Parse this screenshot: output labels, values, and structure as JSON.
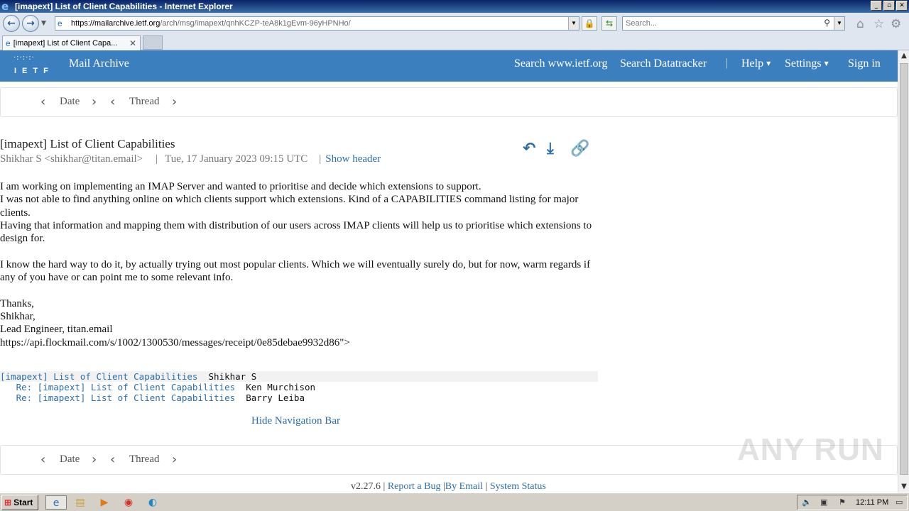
{
  "window": {
    "title": "[imapext] List of Client Capabilities - Internet Explorer",
    "controls": {
      "minimize": "_",
      "maximize": "▫",
      "close": "✕"
    }
  },
  "browser": {
    "url_host": "https://mailarchive.ietf.org",
    "url_path": "/arch/msg/imapext/qnhKCZP-teA8k1gEvm-96yHPNHo/",
    "search_placeholder": "Search...",
    "tab_title": "[imapext] List of Client Capa..."
  },
  "site": {
    "logo_text": "IETF",
    "brand": "Mail Archive",
    "nav": {
      "search_ietf": "Search www.ietf.org",
      "search_datatracker": "Search Datatracker",
      "separator": "|",
      "help": "Help",
      "settings": "Settings",
      "sign_in": "Sign in"
    }
  },
  "msgnav": {
    "date": "Date",
    "thread": "Thread"
  },
  "message": {
    "subject": "[imapext] List of Client Capabilities",
    "from": "Shikhar S <shikhar@titan.email>",
    "date": "Tue, 17 January 2023 09:15 UTC",
    "show_header": "Show header",
    "separator": "|",
    "body": {
      "line1": "I am working on implementing an IMAP Server and wanted to prioritise and decide which extensions to support.",
      "line2": "I was not able to find anything online on which clients support which extensions. Kind of a CAPABILITIES command listing for major clients.",
      "line3": "Having that information and mapping them with distribution of our users across IMAP clients will help us to prioritise which extensions to design for.",
      "line4": "I know the hard way to do it, by actually trying out most popular clients. Which we will eventually surely do, but for now, warm regards if any of you have or can point me to some relevant info.",
      "thanks": "Thanks,",
      "name": "Shikhar,",
      "role": "Lead Engineer, titan.email",
      "receipt": "https://api.flockmail.com/s/1002/1300530/messages/receipt/0e85debae9932d86\">"
    }
  },
  "thread": [
    {
      "subject": "[imapext] List of Client Capabilities",
      "author": "Shikhar S",
      "indent": ""
    },
    {
      "subject": "Re: [imapext] List of Client Capabilities",
      "author": "Ken Murchison",
      "indent": "   "
    },
    {
      "subject": "Re: [imapext] List of Client Capabilities",
      "author": "Barry Leiba",
      "indent": "   "
    }
  ],
  "hide_nav": "Hide Navigation Bar",
  "footer": {
    "version": "v2.27.6",
    "sep": "|",
    "report_bug": "Report a Bug",
    "by_email": "By Email",
    "system_status": "System Status"
  },
  "watermark": "ANY RUN",
  "taskbar": {
    "start": "Start",
    "clock": "12:11 PM"
  },
  "icons": [
    "ie-icon",
    "back-icon",
    "forward-icon",
    "lock-icon",
    "refresh-icon",
    "search-icon",
    "home-icon",
    "star-icon",
    "gear-icon",
    "reply-icon",
    "download-icon",
    "link-icon",
    "chevron-left-icon",
    "chevron-right-icon"
  ],
  "colors": {
    "nav_bg": "#3c7fbf",
    "link": "#2a6fac"
  }
}
